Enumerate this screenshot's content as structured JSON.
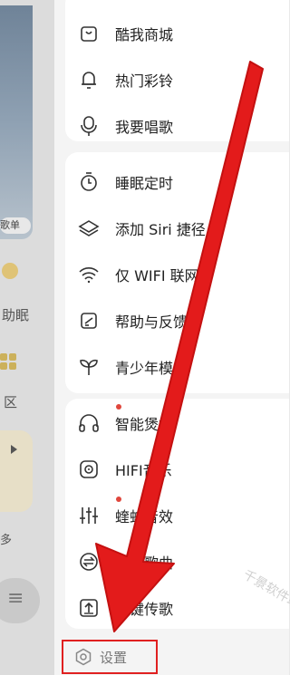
{
  "background": {
    "tag_text": "歌单",
    "sleep_text": "助眠",
    "zone_text": "区",
    "more_text": "多"
  },
  "menu": {
    "group1": [
      {
        "label": "酷我商城",
        "icon": "shopping-bag-icon"
      },
      {
        "label": "热门彩铃",
        "icon": "bell-icon"
      },
      {
        "label": "我要唱歌",
        "icon": "microphone-icon"
      }
    ],
    "group2": [
      {
        "label": "睡眠定时",
        "icon": "timer-icon"
      },
      {
        "label": "添加 Siri 捷径",
        "icon": "layers-icon"
      },
      {
        "label": "仅 WIFI 联网",
        "icon": "wifi-icon"
      },
      {
        "label": "帮助与反馈",
        "icon": "feedback-icon"
      },
      {
        "label": "青少年模式",
        "icon": "sprout-icon"
      }
    ],
    "group3": [
      {
        "label": "智能煲机",
        "icon": "headphones-icon",
        "badge": true
      },
      {
        "label": "HIFI音乐",
        "icon": "disc-icon"
      },
      {
        "label": "蝰蛇音效",
        "icon": "equalizer-icon",
        "badge": true
      },
      {
        "label": "互传歌曲",
        "icon": "transfer-icon"
      },
      {
        "label": "一键传歌",
        "icon": "upload-icon"
      }
    ]
  },
  "settings": {
    "label": "设置",
    "icon": "gear-icon"
  },
  "watermark": "千景软件站",
  "colors": {
    "arrow": "#e31b1b",
    "highlight_border": "#e02020",
    "badge": "#e0463c"
  }
}
